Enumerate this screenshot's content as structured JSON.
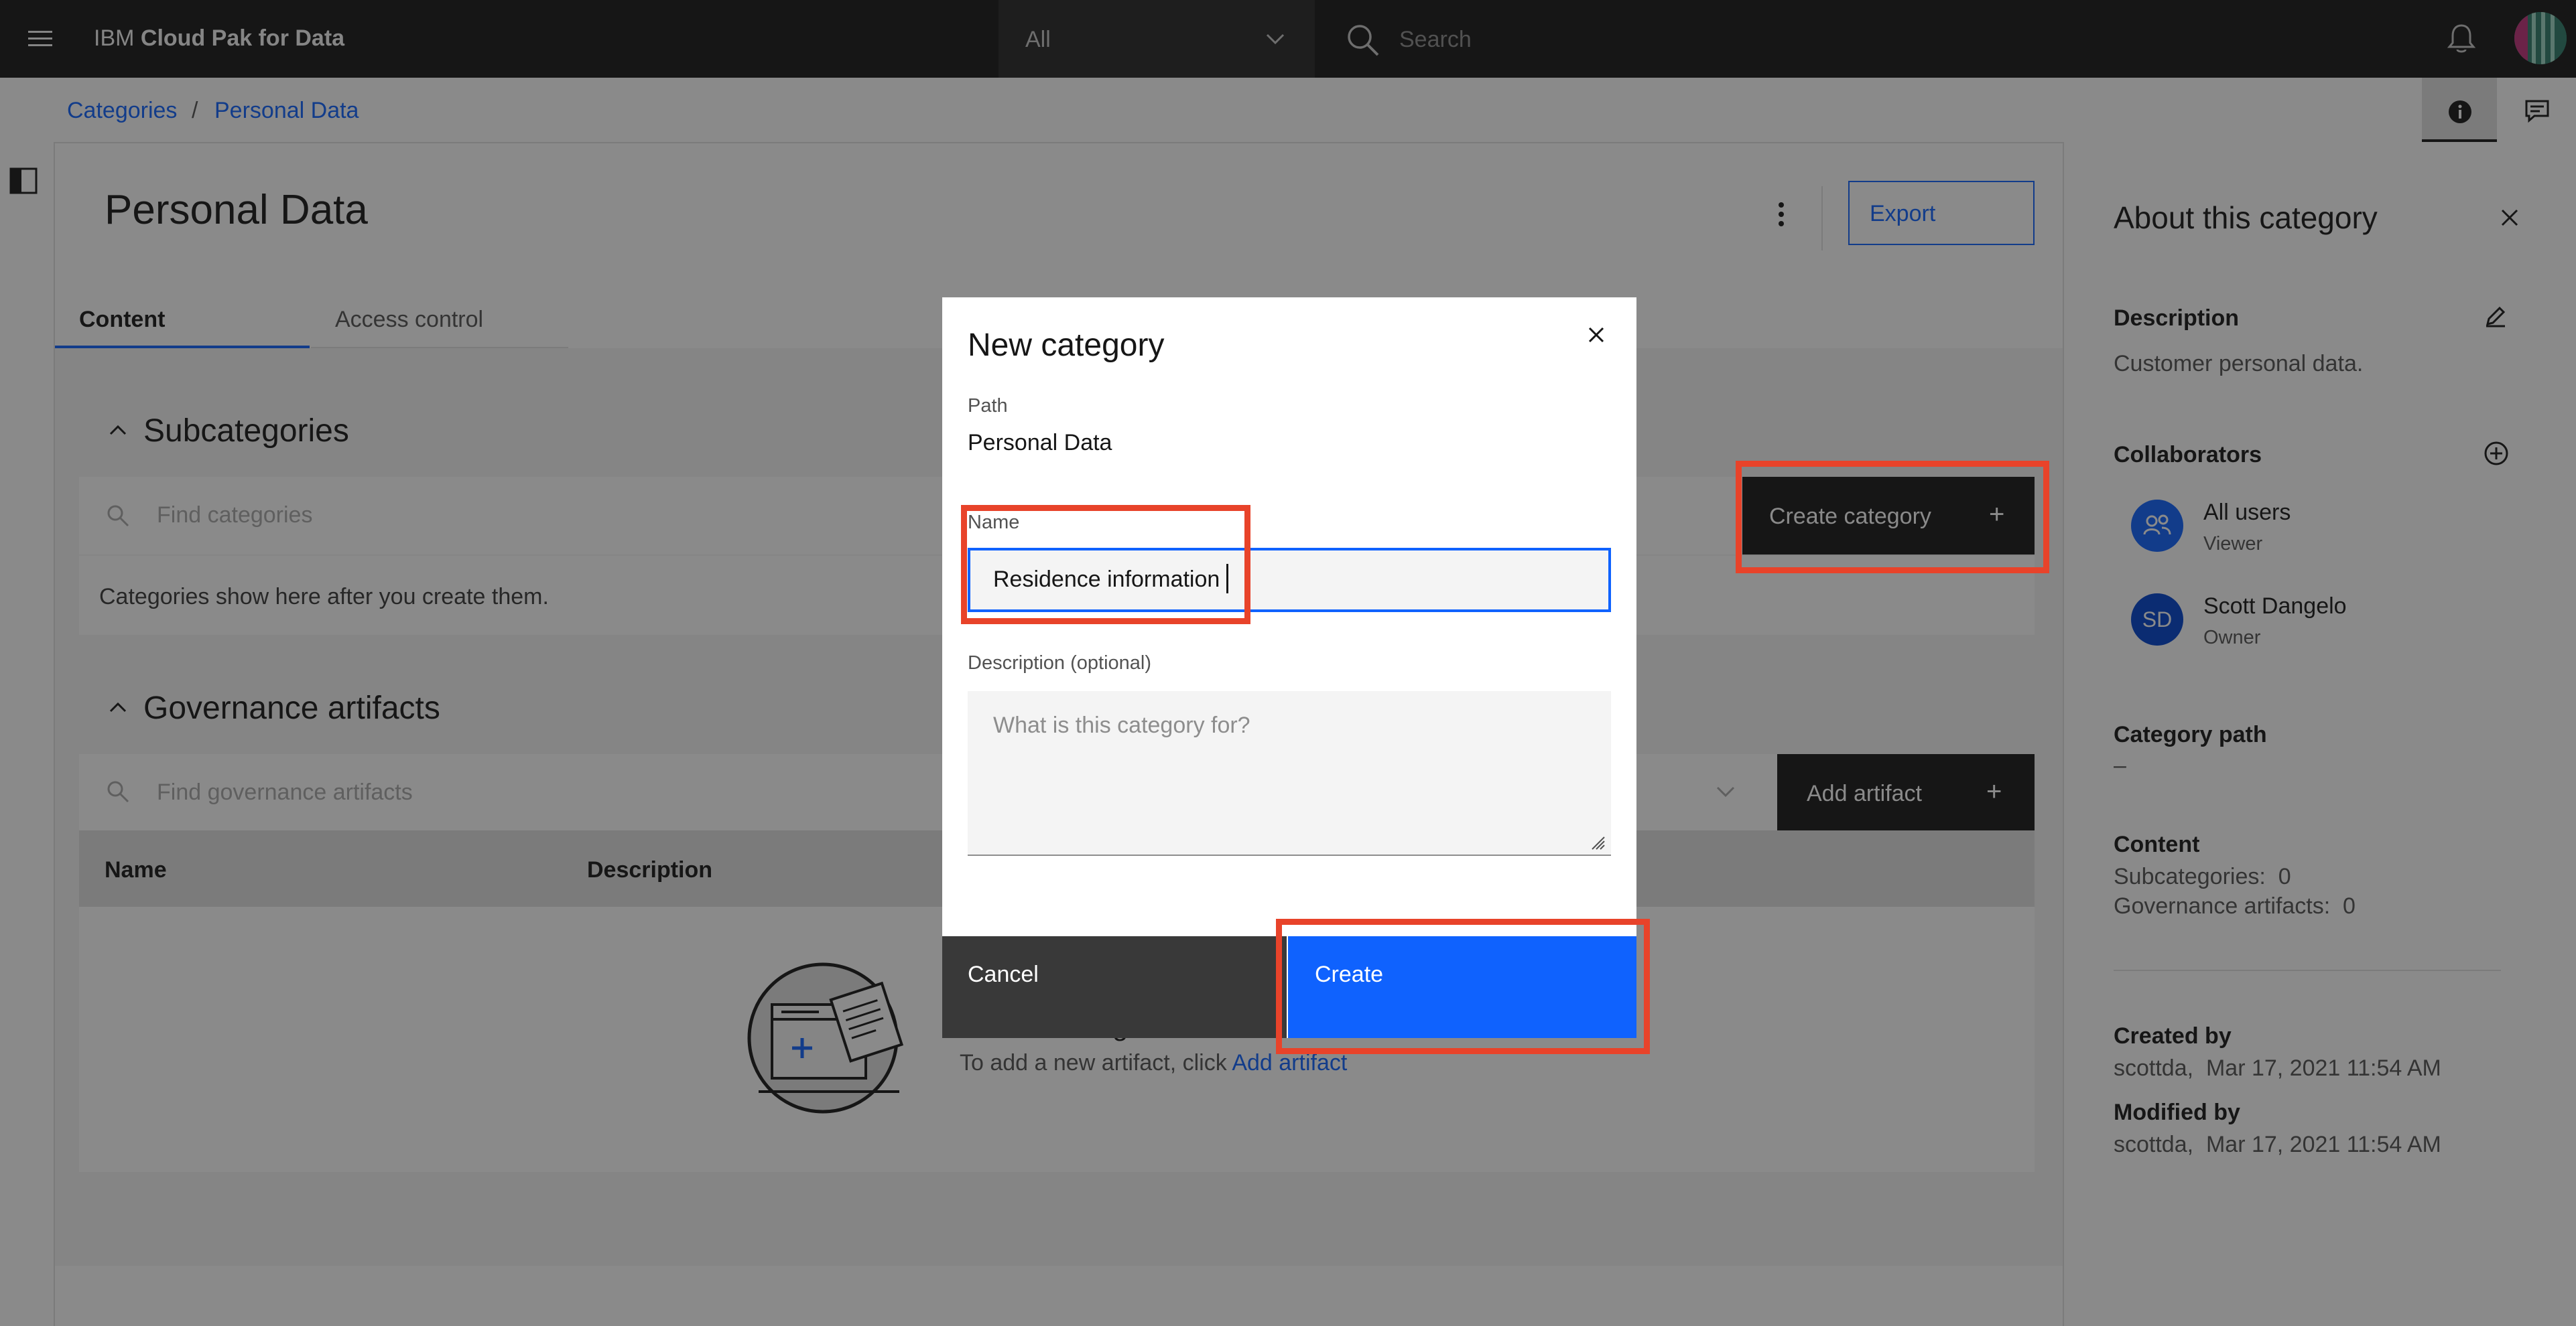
{
  "topbar": {
    "brand_prefix": "IBM",
    "brand_name": "Cloud Pak for Data",
    "scope": "All",
    "search_placeholder": "Search"
  },
  "breadcrumb": {
    "items": [
      "Categories",
      "Personal Data"
    ],
    "separator": "/"
  },
  "main": {
    "title": "Personal Data",
    "export_label": "Export",
    "tabs": [
      "Content",
      "Access control"
    ],
    "subcategories": {
      "title": "Subcategories",
      "search_placeholder": "Find categories",
      "create_label": "Create category",
      "empty_text": "Categories show here after you create them."
    },
    "artifacts": {
      "title": "Governance artifacts",
      "search_placeholder": "Find governance artifacts",
      "add_label": "Add artifact",
      "columns": [
        "Name",
        "Description"
      ],
      "empty_hint_prefix": "To add a new artifact, click",
      "empty_hint_link": "Add artifact",
      "partial_text": "g"
    }
  },
  "right_panel": {
    "title": "About this category",
    "description_label": "Description",
    "description_text": "Customer personal data.",
    "collaborators_label": "Collaborators",
    "collaborators": [
      {
        "name": "All users",
        "role": "Viewer",
        "icon": "user-group-icon"
      },
      {
        "name": "Scott Dangelo",
        "role": "Owner",
        "initials": "SD"
      }
    ],
    "category_path_label": "Category path",
    "category_path_value": "–",
    "content_label": "Content",
    "subcategories_count": "Subcategories:  0",
    "artifacts_count": "Governance artifacts:  0",
    "created_by_label": "Created by",
    "created_by_value": "scottda,  Mar 17, 2021 11:54 AM",
    "modified_by_label": "Modified by",
    "modified_by_value": "scottda,  Mar 17, 2021 11:54 AM"
  },
  "modal": {
    "title": "New category",
    "path_label": "Path",
    "path_value": "Personal Data",
    "name_label": "Name",
    "name_value": "Residence information",
    "description_label": "Description (optional)",
    "description_placeholder": "What is this category for?",
    "cancel_label": "Cancel",
    "create_label": "Create"
  },
  "colors": {
    "accent": "#0f62fe",
    "header_bg": "#161616",
    "highlight": "#e8432a"
  }
}
